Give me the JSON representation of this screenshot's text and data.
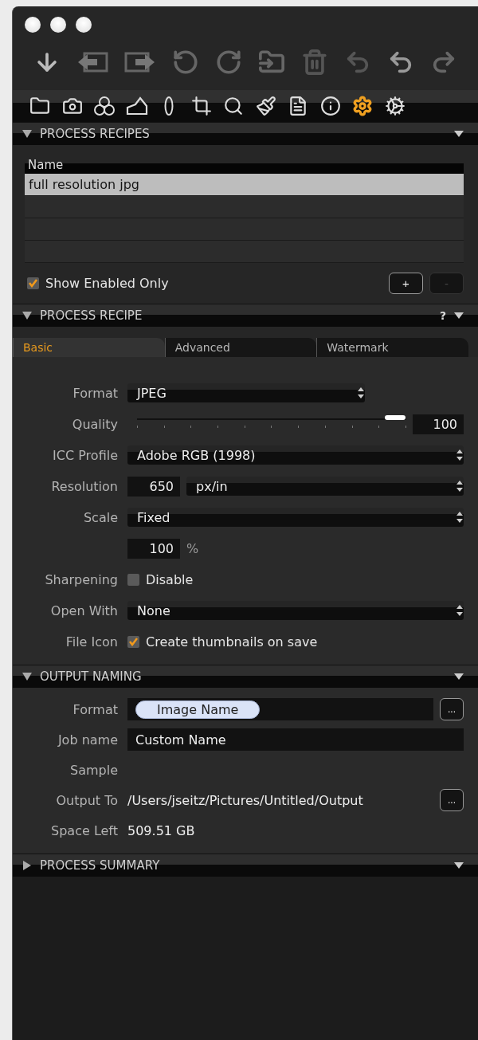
{
  "tool_tabs": [
    {
      "selected": false
    },
    {
      "selected": false
    },
    {
      "selected": false
    },
    {
      "selected": false
    },
    {
      "selected": false
    },
    {
      "selected": false
    },
    {
      "selected": false
    },
    {
      "selected": false
    },
    {
      "selected": false
    },
    {
      "selected": false
    },
    {
      "selected": true
    },
    {
      "selected": false
    }
  ],
  "process_recipes": {
    "title": "PROCESS RECIPES",
    "expanded": true,
    "column": "Name",
    "rows": [
      {
        "name": "full resolution jpg",
        "selected": true
      }
    ],
    "show_enabled_only": {
      "label": "Show Enabled Only",
      "checked": true
    },
    "buttons": [
      {
        "label": "+",
        "disabled": false
      },
      {
        "label": "-",
        "disabled": true
      }
    ]
  },
  "process_recipe": {
    "title": "PROCESS RECIPE",
    "expanded": true,
    "help": "?",
    "tabs": [
      {
        "label": "Basic",
        "selected": true
      },
      {
        "label": "Advanced",
        "selected": false
      },
      {
        "label": "Watermark",
        "selected": false
      }
    ],
    "rows": [
      {
        "kind": "short-select",
        "label": "Format",
        "value": "JPEG"
      },
      {
        "kind": "slider",
        "label": "Quality",
        "level": 0.96,
        "value": "100"
      },
      {
        "kind": "select",
        "label": "ICC Profile",
        "value": "Adobe RGB (1998)"
      },
      {
        "kind": "number-select",
        "label": "Resolution",
        "value": "650",
        "unit": "px/in"
      },
      {
        "kind": "select",
        "label": "Scale",
        "value": "Fixed"
      },
      {
        "kind": "number-unit",
        "value": "100",
        "unit": "%"
      },
      {
        "kind": "checkbox",
        "label": "Sharpening",
        "text": "Disable",
        "checked": false
      },
      {
        "kind": "select",
        "label": "Open With",
        "value": "None"
      },
      {
        "kind": "checkbox",
        "label": "File Icon",
        "text": "Create thumbnails on save",
        "checked": true
      }
    ]
  },
  "output_naming": {
    "title": "OUTPUT NAMING",
    "expanded": true,
    "rows": [
      {
        "kind": "token",
        "label": "Format",
        "token": "Image Name",
        "button": "..."
      },
      {
        "kind": "field",
        "label": "Job name",
        "value": "Custom Name"
      },
      {
        "kind": "empty",
        "label": "Sample"
      },
      {
        "kind": "path",
        "label": "Output To",
        "value": "/Users/jseitz/Pictures/Untitled/Output",
        "button": "..."
      },
      {
        "kind": "text",
        "label": "Space Left",
        "value": "509.51 GB"
      }
    ]
  },
  "process_summary": {
    "title": "PROCESS SUMMARY",
    "expanded": false
  }
}
